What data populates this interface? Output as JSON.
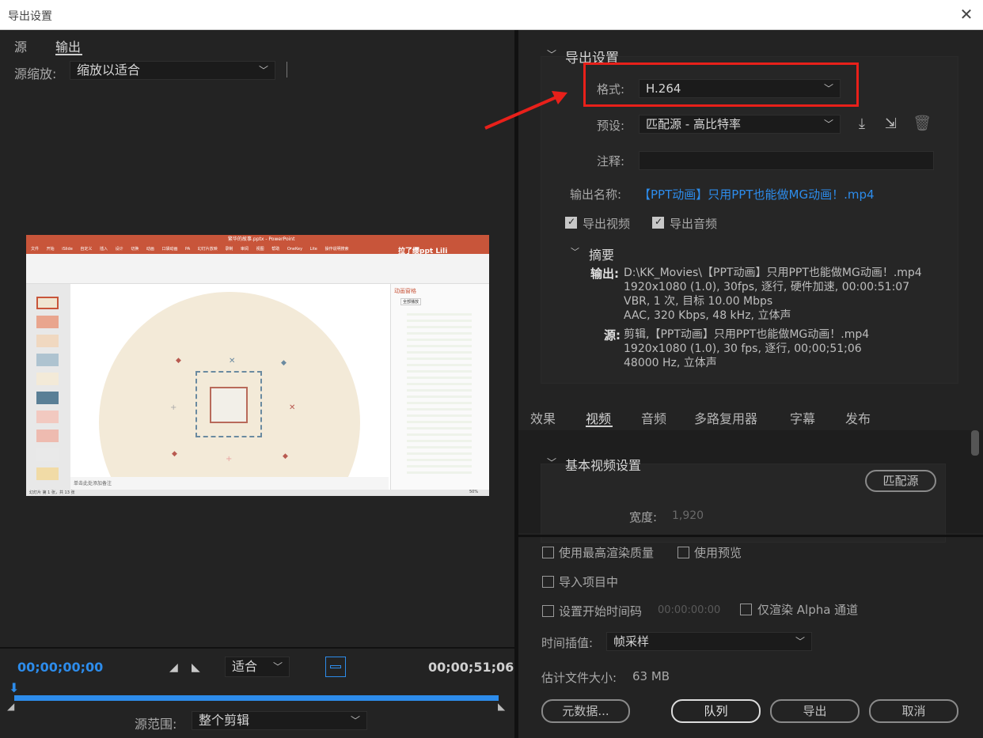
{
  "window": {
    "title": "导出设置",
    "close": "✕"
  },
  "left": {
    "tabs": [
      "源",
      "输出"
    ],
    "scale_label": "源缩放:",
    "scale_value": "缩放以适合",
    "timecode_start": "00;00;00;00",
    "timecode_end": "00;00;51;06",
    "fit_value": "适合",
    "range_label": "源范围:",
    "range_value": "整个剪辑",
    "preview": {
      "app_title": "繁华的故事.pptx - PowerPoint",
      "ribbon_tabs": [
        "文件",
        "开始",
        "iSlide",
        "自定义",
        "插入",
        "设计",
        "切换",
        "动画",
        "口袋动画 PA",
        "幻灯片放映",
        "录制",
        "审阅",
        "视图",
        "帮助",
        "OneKey Lite",
        "操作说明搜索"
      ],
      "brand": "拉了缨ppt Lili",
      "pane_title": "动画窗格",
      "play_all": "全部播放",
      "notes": "单击此处添加备注",
      "status": "幻灯片 第 1 张，共 13 张",
      "zoom": "50%"
    }
  },
  "export": {
    "section_title": "导出设置",
    "format_label": "格式:",
    "format_value": "H.264",
    "preset_label": "预设:",
    "preset_value": "匹配源 - 高比特率",
    "comment_label": "注释:",
    "output_name_label": "输出名称:",
    "output_name_value": "【PPT动画】只用PPT也能做MG动画！.mp4",
    "export_video": "导出视频",
    "export_audio": "导出音频",
    "summary_title": "摘要",
    "summary_output_label": "输出:",
    "summary_output_lines": [
      "D:\\KK_Movies\\【PPT动画】只用PPT也能做MG动画！.mp4",
      "1920x1080 (1.0), 30fps, 逐行, 硬件加速, 00:00:51:07",
      "VBR, 1 次, 目标 10.00 Mbps",
      "AAC, 320 Kbps, 48  kHz, 立体声"
    ],
    "summary_source_label": "源:",
    "summary_source_lines": [
      "剪辑,【PPT动画】只用PPT也能做MG动画！.mp4",
      "1920x1080 (1.0), 30 fps, 逐行, 00;00;51;06",
      "48000 Hz, 立体声"
    ]
  },
  "settings_tabs": [
    "效果",
    "视频",
    "音频",
    "多路复用器",
    "字幕",
    "发布"
  ],
  "video": {
    "section_title": "基本视频设置",
    "match_source": "匹配源",
    "width_label": "宽度:",
    "width_value": "1,920"
  },
  "bottom": {
    "max_quality": "使用最高渲染质量",
    "use_preview": "使用预览",
    "import_project": "导入项目中",
    "set_start_tc": "设置开始时间码",
    "start_tc_value": "00:00:00:00",
    "alpha_only": "仅渲染 Alpha 通道",
    "interp_label": "时间插值:",
    "interp_value": "帧采样",
    "est_size_label": "估计文件大小:",
    "est_size_value": "63 MB",
    "metadata_btn": "元数据...",
    "queue_btn": "队列",
    "export_btn": "导出",
    "cancel_btn": "取消"
  },
  "colors": {
    "accent_blue": "#2d8ceb",
    "highlight_red": "#e8201a",
    "ppt_orange": "#c8553a"
  }
}
